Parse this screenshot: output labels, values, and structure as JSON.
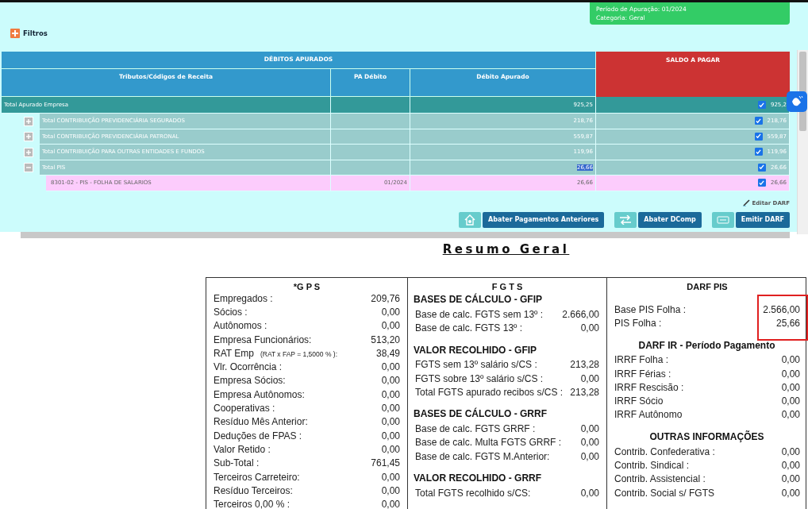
{
  "period_card": {
    "lines": [
      "Período de Apuração: 01/2024",
      "Categoria: Geral"
    ]
  },
  "filters": {
    "label": "Filtros"
  },
  "debits_table": {
    "group_header": "DÉBITOS APURADOS",
    "balance_header": "SALDO A PAGAR",
    "columns": [
      "Tributos/Códigos de Receita",
      "PA Débito",
      "Débito Apurado"
    ],
    "rows": [
      {
        "kind": "total",
        "label": "Total Apurado Empresa",
        "pa": "",
        "debit": "925,25",
        "highlighted": false,
        "checked": true,
        "balance": "925,2"
      },
      {
        "kind": "group",
        "expanded": false,
        "label": "Total CONTRIBUIÇÃO PREVIDENCIÁRIA SEGURADOS",
        "pa": "",
        "debit": "218,76",
        "highlighted": false,
        "checked": true,
        "balance": "218,76"
      },
      {
        "kind": "group",
        "expanded": false,
        "label": "Total CONTRIBUIÇÃO PREVIDENCIÁRIA PATRONAL",
        "pa": "",
        "debit": "559,87",
        "highlighted": false,
        "checked": true,
        "balance": "559,87"
      },
      {
        "kind": "group",
        "expanded": false,
        "label": "Total CONTRIBUIÇÃO PARA OUTRAS ENTIDADES E FUNDOS",
        "pa": "",
        "debit": "119,96",
        "highlighted": false,
        "checked": true,
        "balance": "119,96"
      },
      {
        "kind": "group",
        "expanded": true,
        "label": "Total PIS",
        "pa": "",
        "debit": "26,66",
        "highlighted": true,
        "checked": true,
        "balance": "26,66"
      },
      {
        "kind": "item",
        "label": "8301-02 - PIS - FOLHA DE SALARIOS",
        "pa": "01/2024",
        "debit": "26,66",
        "highlighted": false,
        "checked": true,
        "balance": "26,66"
      }
    ]
  },
  "edit_link": "Editar DARF",
  "actions": [
    {
      "kind": "house",
      "label": "Abater Pagamentos Anteriores"
    },
    {
      "kind": "swap",
      "label": "Abater DComp"
    },
    {
      "kind": "document",
      "label": "Emitir DARF"
    }
  ],
  "summary": {
    "title": "Resumo Geral",
    "panels": [
      {
        "title": "*G P S",
        "kind": "plain",
        "sections": [
          {
            "rows": [
              {
                "label": "Empregados :",
                "value": "209,76"
              },
              {
                "label": "Sócios :",
                "value": "0,00"
              },
              {
                "label": "Autônomos :",
                "value": "0,00"
              },
              {
                "label": "Empresa Funcionários:",
                "value": "513,20"
              },
              {
                "label": "RAT Emp",
                "note": "(RAT x FAP =   1,5000 % ):",
                "value": "38,49"
              },
              {
                "label": "Vlr. Ocorrência :",
                "value": "0,00"
              },
              {
                "label": "Empresa Sócios:",
                "value": "0,00"
              },
              {
                "label": "Empresa Autônomos:",
                "value": "0,00"
              },
              {
                "label": "Cooperativas :",
                "value": "0,00"
              },
              {
                "label": "Resíduo Mês Anterior:",
                "value": "0,00"
              },
              {
                "label": "Deduções de FPAS :",
                "value": "0,00"
              },
              {
                "label": "Valor Retido :",
                "value": "0,00"
              },
              {
                "label": "Sub-Total :",
                "value": "761,45"
              },
              {
                "label": "Terceiros Carreteiro:",
                "value": "0,00"
              },
              {
                "label": "Resíduo Terceiros:",
                "value": "0,00"
              },
              {
                "label": "Terceiros 0,00 % :",
                "value": "0,00"
              }
            ]
          }
        ]
      },
      {
        "title": "F G T S",
        "kind": "grouped",
        "sections": [
          {
            "heading": "BASES DE CÁLCULO - GFIP",
            "rows": [
              {
                "label": "Base de calc. FGTS sem 13º :",
                "value": "2.666,00"
              },
              {
                "label": "Base de calc. FGTS 13º :",
                "value": "0,00"
              }
            ]
          },
          {
            "heading": "VALOR RECOLHIDO - GFIP",
            "rows": [
              {
                "label": "FGTS sem 13º salário s/CS :",
                "value": "213,28"
              },
              {
                "label": "FGTS sobre 13º salário s/CS :",
                "value": "0,00"
              },
              {
                "label": "Total FGTS apurado recibos s/CS :",
                "value": "213,28"
              }
            ]
          },
          {
            "heading": "BASES DE CÁLCULO - GRRF",
            "rows": [
              {
                "label": "Base de calc. FGTS GRRF :",
                "value": "0,00"
              },
              {
                "label": "Base de calc. Multa FGTS GRRF :",
                "value": "0,00"
              },
              {
                "label": "Base de calc. FGTS M.Anterior:",
                "value": "0,00"
              }
            ]
          },
          {
            "heading": "VALOR RECOLHIDO - GRRF",
            "rows": [
              {
                "label": "Total FGTS recolhido s/CS:",
                "value": "0,00"
              }
            ]
          }
        ]
      },
      {
        "title": "DARF PIS",
        "kind": "centered",
        "sections": [
          {
            "highlighted": true,
            "rows": [
              {
                "label": "Base PIS Folha :",
                "value": "2.566,00"
              },
              {
                "label": "PIS Folha :",
                "value": "25,66"
              }
            ]
          },
          {
            "heading": "DARF IR - Período Pagamento",
            "highlighted": false,
            "rows": [
              {
                "label": "IRRF Folha :",
                "value": "0,00"
              },
              {
                "label": "IRRF Férias :",
                "value": "0,00"
              },
              {
                "label": "IRRF Rescisão :",
                "value": "0,00"
              },
              {
                "label": "IRRF Sócio",
                "value": "0,00"
              },
              {
                "label": "IRRF Autônomo",
                "value": "0,00"
              }
            ]
          },
          {
            "heading": "OUTRAS INFORMAÇÕES",
            "highlighted": false,
            "rows": [
              {
                "label": "Contrib. Confederativa :",
                "value": "0,00"
              },
              {
                "label": "Contrib. Sindical :",
                "value": "0,00"
              },
              {
                "label": "Contrib. Assistencial :",
                "value": "0,00"
              },
              {
                "label": "Contrib. Social s/ FGTS",
                "value": "0,00"
              }
            ]
          }
        ]
      }
    ]
  }
}
